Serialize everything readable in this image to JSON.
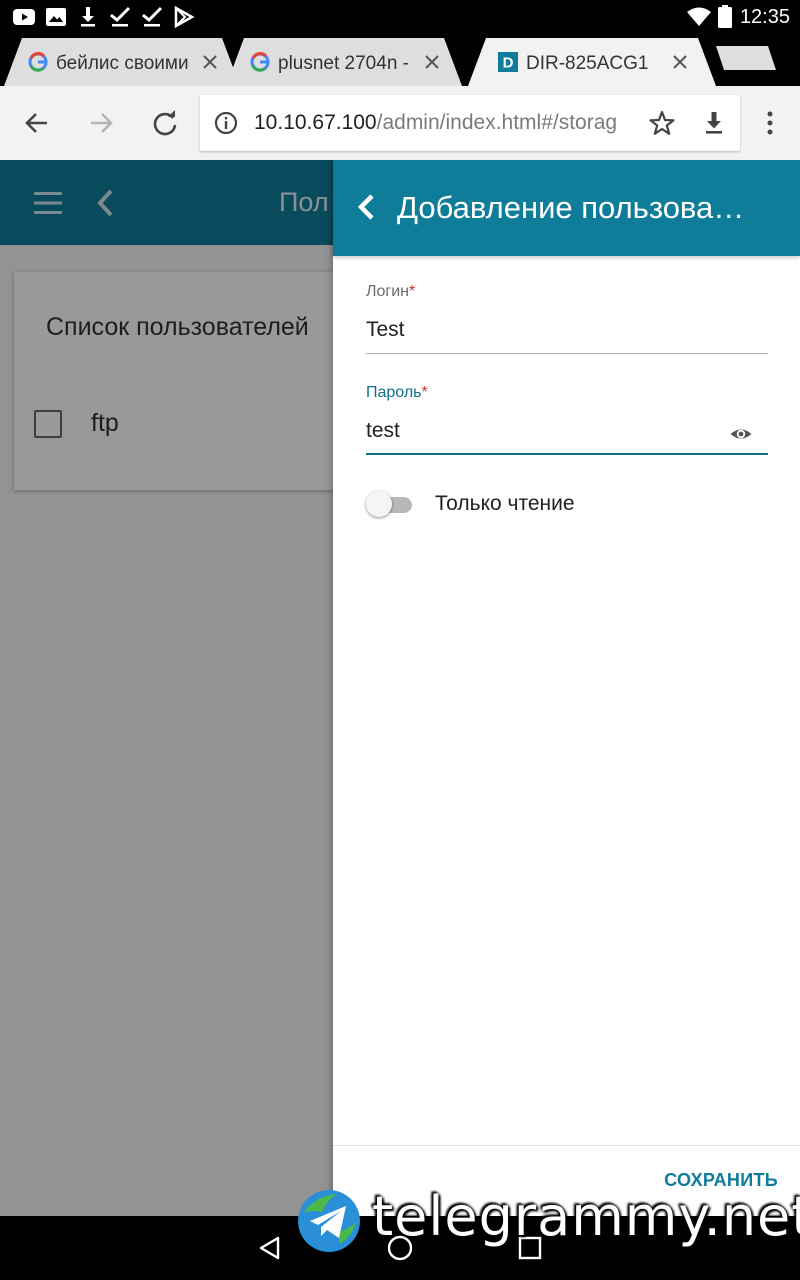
{
  "status_bar": {
    "time": "12:35",
    "left_icons": [
      "youtube-icon",
      "image-icon",
      "download-icon",
      "check-icon",
      "check-icon",
      "play-store-icon"
    ],
    "right_icons": [
      "wifi-icon",
      "battery-icon"
    ]
  },
  "browser": {
    "tabs": [
      {
        "title": "бейлис своими",
        "favicon": "google-icon",
        "active": false
      },
      {
        "title": "plusnet 2704n -",
        "favicon": "google-icon",
        "active": false
      },
      {
        "title": "DIR-825ACG1",
        "favicon": "dlink-icon",
        "active": true
      }
    ],
    "url_host": "10.10.67.100",
    "url_path": "/admin/index.html#/storag"
  },
  "app": {
    "header_title": "Пол",
    "card_title": "Список пользователей",
    "users": [
      {
        "name": "ftp"
      }
    ]
  },
  "drawer": {
    "title": "Добавление пользова…",
    "login_label": "Логин",
    "login_value": "Test",
    "password_label": "Пароль",
    "password_value": "test",
    "required_mark": "*",
    "readonly_label": "Только чтение",
    "readonly_on": false,
    "save_label": "СОХРАНИТЬ"
  },
  "colors": {
    "accent": "#0f7d9a",
    "field_active": "#0f6f8a",
    "required": "#c0392b"
  },
  "watermark": {
    "text": "telegrammy.net"
  }
}
